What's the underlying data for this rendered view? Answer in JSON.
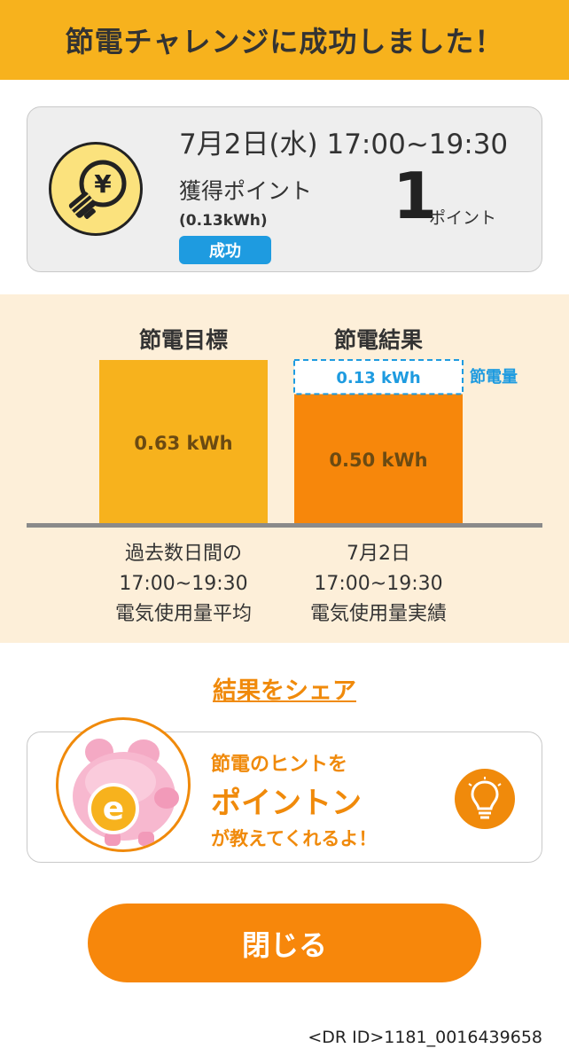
{
  "header": {
    "title": "節電チャレンジに成功しました！"
  },
  "summary": {
    "date_time": "7月2日(水) 17:00~19:30",
    "points_label": "獲得ポイント",
    "kwh": "(0.13kWh)",
    "status": "成功",
    "points_value": "1",
    "points_unit": "ポイント",
    "icon": "lightbulb-yen-icon"
  },
  "chart_data": {
    "type": "bar",
    "categories": [
      "節電目標",
      "節電結果"
    ],
    "series": [
      {
        "name": "電気使用量",
        "values": [
          0.63,
          0.5
        ]
      },
      {
        "name": "節電量",
        "values": [
          0,
          0.13
        ]
      }
    ],
    "value_labels": [
      "0.63 kWh",
      "0.50 kWh"
    ],
    "saving_value_label": "0.13 kWh",
    "saving_legend": "節電量",
    "ylim": [
      0,
      0.63
    ],
    "captions": [
      [
        "過去数日間の",
        "17:00~19:30",
        "電気使用量平均"
      ],
      [
        "7月2日",
        "17:00~19:30",
        "電気使用量実績"
      ]
    ],
    "colors": {
      "target": "#f7b21d",
      "result": "#f7870b",
      "saving": "#1e9be0",
      "baseline": "#8a8a8a"
    }
  },
  "share": {
    "label": "結果をシェア"
  },
  "hint": {
    "line1": "節電のヒントを",
    "line2": "ポイントン",
    "line3": "が教えてくれるよ！",
    "mascot_letter": "e"
  },
  "close_button": {
    "label": "閉じる"
  },
  "footer": {
    "dr_id": "<DR ID>1181_0016439658"
  }
}
